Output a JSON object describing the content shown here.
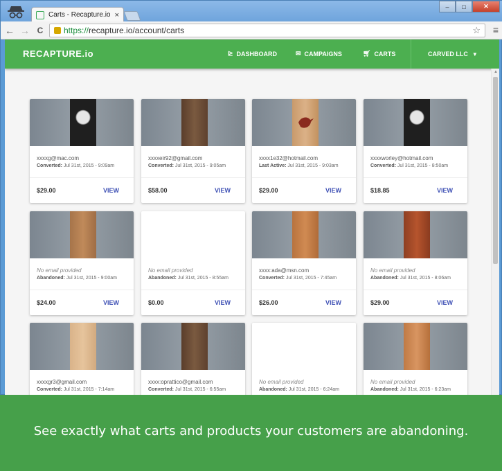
{
  "browser": {
    "tab_title": "Carts - Recapture.io",
    "tab_close": "×",
    "url_scheme": "https://",
    "url_rest": "recapture.io/account/carts",
    "back_glyph": "←",
    "forward_glyph": "→",
    "reload_glyph": "C",
    "star_glyph": "☆",
    "menu_glyph": "≡",
    "minimize_glyph": "–",
    "maximize_glyph": "□",
    "close_glyph": "✕"
  },
  "app": {
    "brand": "RECAPTURE.io",
    "nav": {
      "dashboard": "DASHBOARD",
      "campaigns": "CAMPAIGNS",
      "carts": "CARTS"
    },
    "nav_icons": {
      "dashboard": "chart-icon",
      "campaigns": "mail-icon",
      "carts": "cart-icon"
    },
    "account": "CARVED LLC",
    "accent_color": "#4caf50",
    "link_color": "#3f51b5"
  },
  "carts": [
    {
      "email": "xxxxg@mac.com",
      "status_label": "Converted:",
      "status_date": "Jul 31st, 2015 - 9:09am",
      "price": "$29.00",
      "action": "VIEW",
      "image": "moon"
    },
    {
      "email": "xxxxeir92@gmail.com",
      "status_label": "Converted:",
      "status_date": "Jul 31st, 2015 - 9:05am",
      "price": "$58.00",
      "action": "VIEW",
      "image": "wood"
    },
    {
      "email": "xxxx1e32@hotmail.com",
      "status_label": "Last Active:",
      "status_date": "Jul 31st, 2015 - 9:03am",
      "price": "$29.00",
      "action": "VIEW",
      "image": "bird"
    },
    {
      "email": "xxxxworley@hotmail.com",
      "status_label": "Converted:",
      "status_date": "Jul 31st, 2015 - 8:50am",
      "price": "$18.85",
      "action": "VIEW",
      "image": "moon"
    },
    {
      "email": "No email provided",
      "status_label": "Abandoned:",
      "status_date": "Jul 31st, 2015 - 9:00am",
      "price": "$24.00",
      "action": "VIEW",
      "image": "wood-light"
    },
    {
      "email": "No email provided",
      "status_label": "Abandoned:",
      "status_date": "Jul 31st, 2015 - 8:55am",
      "price": "$0.00",
      "action": "VIEW",
      "image": "none"
    },
    {
      "email": "xxxx:ada@msn.com",
      "status_label": "Converted:",
      "status_date": "Jul 31st, 2015 - 7:45am",
      "price": "$26.00",
      "action": "VIEW",
      "image": "cedar"
    },
    {
      "email": "No email provided",
      "status_label": "Abandoned:",
      "status_date": "Jul 31st, 2015 - 8:06am",
      "price": "$29.00",
      "action": "VIEW",
      "image": "redwood"
    },
    {
      "email": "xxxxgr3@gmail.com",
      "status_label": "Converted:",
      "status_date": "Jul 31st, 2015 - 7:14am",
      "price": "",
      "action": "",
      "image": "map"
    },
    {
      "email": "xxxx:oprattico@gmail.com",
      "status_label": "Converted:",
      "status_date": "Jul 31st, 2015 - 6:55am",
      "price": "",
      "action": "",
      "image": "wood"
    },
    {
      "email": "No email provided",
      "status_label": "Abandoned:",
      "status_date": "Jul 31st, 2015 - 6:24am",
      "price": "",
      "action": "",
      "image": "none"
    },
    {
      "email": "No email provided",
      "status_label": "Abandoned:",
      "status_date": "Jul 31st, 2015 - 6:23am",
      "price": "",
      "action": "",
      "image": "cedar-light"
    }
  ],
  "banner": {
    "text": "See exactly what carts and products your customers are abandoning.",
    "color": "#46a04a"
  }
}
